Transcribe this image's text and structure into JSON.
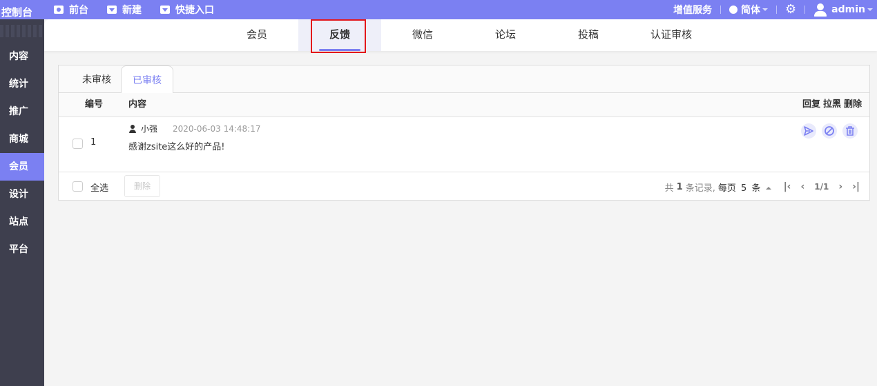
{
  "topbar": {
    "logo": "控制台",
    "nav": [
      {
        "label": "前台",
        "icon": "eye-icon"
      },
      {
        "label": "新建",
        "icon": "dropdown-icon"
      },
      {
        "label": "快捷入口",
        "icon": "dropdown-icon"
      }
    ],
    "value_service": "增值服务",
    "language": "简体",
    "username": "admin"
  },
  "sidebar": {
    "items": [
      "内容",
      "统计",
      "推广",
      "商城",
      "会员",
      "设计",
      "站点",
      "平台"
    ],
    "active": "会员"
  },
  "subnav": {
    "tabs": [
      "会员",
      "反馈",
      "微信",
      "论坛",
      "投稿",
      "认证审核"
    ],
    "active": "反馈"
  },
  "panel": {
    "tabs": [
      "未审核",
      "已审核"
    ],
    "active_tab": "已审核",
    "headers": {
      "id": "编号",
      "content": "内容",
      "reply": "回复",
      "block": "拉黑",
      "delete": "删除"
    },
    "rows": [
      {
        "id": "1",
        "author": "小强",
        "time": "2020-06-03 14:48:17",
        "content": "感谢zsite这么好的产品!"
      }
    ],
    "footer": {
      "select_all": "全选",
      "delete_button": "删除",
      "total_text": "共",
      "total_count": "1",
      "total_suffix": "条记录,",
      "per_page_label": "每页",
      "per_page": "5",
      "per_page_suffix": "条",
      "page_info": "1/1"
    }
  },
  "colors": {
    "accent": "#7b80f2",
    "sidebar": "#3e3f4e",
    "highlight": "#e3161b"
  }
}
